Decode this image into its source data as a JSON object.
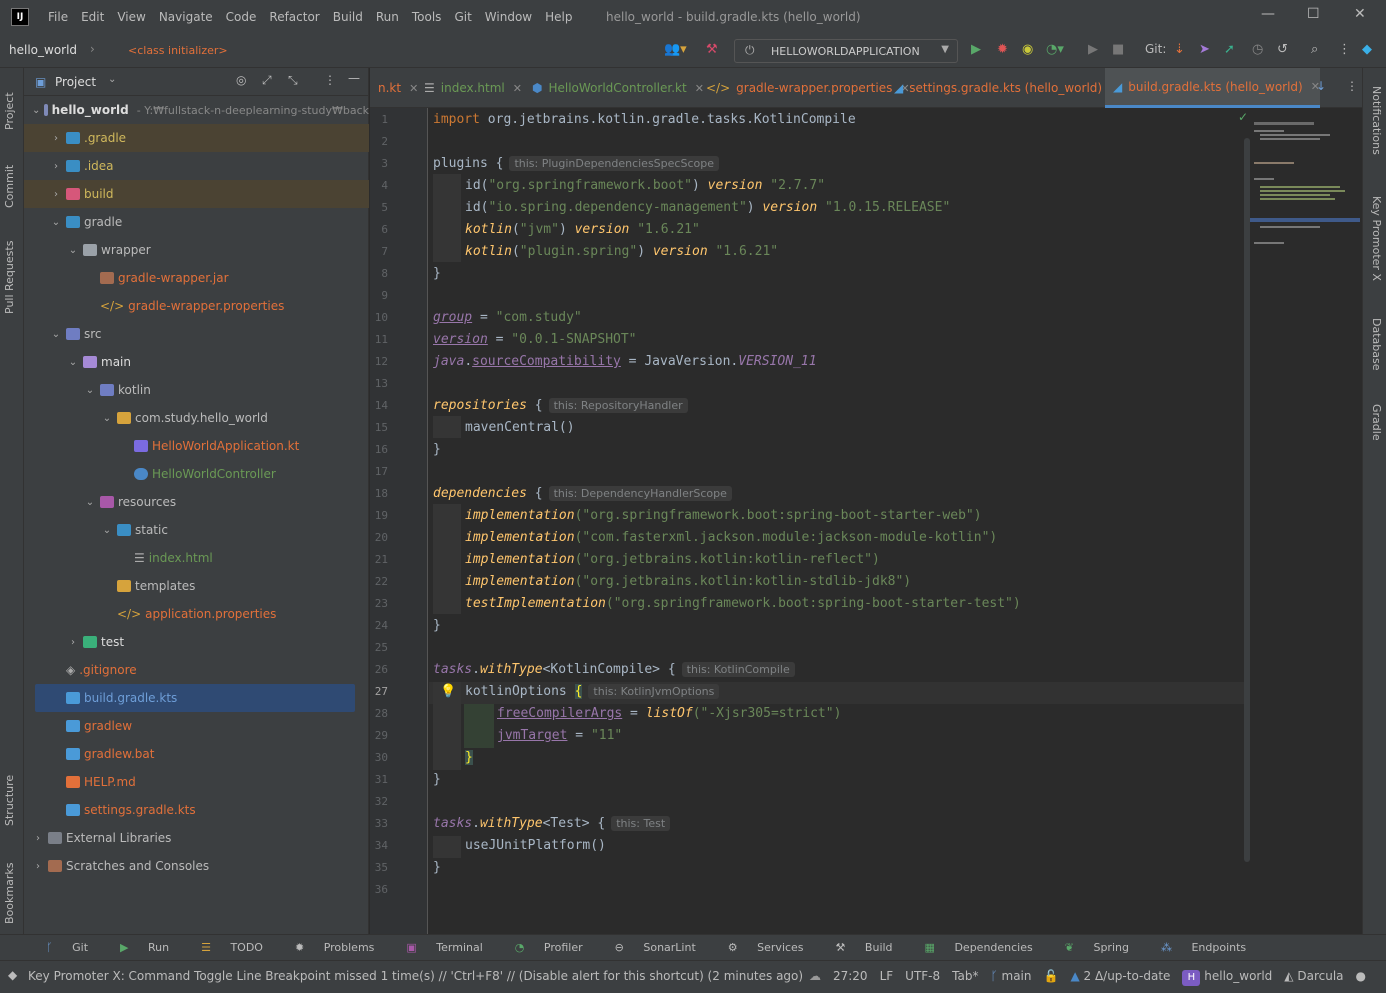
{
  "menubar": {
    "logo": "IJ",
    "items": [
      "File",
      "Edit",
      "View",
      "Navigate",
      "Code",
      "Refactor",
      "Build",
      "Run",
      "Tools",
      "Git",
      "Window",
      "Help"
    ],
    "title": "hello_world - build.gradle.kts (hello_world)",
    "min": "—",
    "max": "☐",
    "close": "✕"
  },
  "navbar": {
    "project": "hello_world",
    "breadcrumb": "<class initializer>",
    "run_config": "HELLOWORLDAPPLICATION",
    "git_label": "Git:"
  },
  "left_strip": [
    "Project",
    "Commit",
    "Pull Requests",
    "Structure",
    "Bookmarks"
  ],
  "right_strip": [
    "Notifications",
    "Key Promoter X",
    "Database",
    "Gradle"
  ],
  "project_panel": {
    "title": "Project",
    "root_name": "hello_world",
    "root_path": "- Y:₩fullstack-n-deeplearning-study₩back",
    "items": [
      {
        "label": ".gradle",
        "color": "#d0b85c"
      },
      {
        "label": ".idea",
        "color": "#d0b85c"
      },
      {
        "label": "build",
        "color": "#d0b85c"
      },
      {
        "label": "gradle",
        "color": "#bbbbbb"
      },
      {
        "label": "wrapper",
        "color": "#bbbbbb"
      },
      {
        "label": "gradle-wrapper.jar",
        "color": "#e2703a"
      },
      {
        "label": "gradle-wrapper.properties",
        "color": "#e2703a"
      },
      {
        "label": "src",
        "color": "#bbbbbb"
      },
      {
        "label": "main",
        "color": "#dddddd"
      },
      {
        "label": "kotlin",
        "color": "#bbbbbb"
      },
      {
        "label": "com.study.hello_world",
        "color": "#bbbbbb"
      },
      {
        "label": "HelloWorldApplication.kt",
        "color": "#e2703a"
      },
      {
        "label": "HelloWorldController",
        "color": "#6a9955"
      },
      {
        "label": "resources",
        "color": "#bbbbbb"
      },
      {
        "label": "static",
        "color": "#bbbbbb"
      },
      {
        "label": "index.html",
        "color": "#6a9955"
      },
      {
        "label": "templates",
        "color": "#bbbbbb"
      },
      {
        "label": "application.properties",
        "color": "#e2703a"
      },
      {
        "label": "test",
        "color": "#dddddd"
      },
      {
        "label": ".gitignore",
        "color": "#e2703a"
      },
      {
        "label": "build.gradle.kts",
        "color": "#6e9ed8"
      },
      {
        "label": "gradlew",
        "color": "#e2703a"
      },
      {
        "label": "gradlew.bat",
        "color": "#e2703a"
      },
      {
        "label": "HELP.md",
        "color": "#e2703a"
      },
      {
        "label": "settings.gradle.kts",
        "color": "#e2703a"
      },
      {
        "label": "External Libraries",
        "color": "#bbbbbb"
      },
      {
        "label": "Scratches and Consoles",
        "color": "#bbbbbb"
      }
    ]
  },
  "tabs": [
    {
      "label": "n.kt",
      "color": "#e2703a"
    },
    {
      "label": "index.html",
      "color": "#6a9955"
    },
    {
      "label": "HelloWorldController.kt",
      "color": "#6a9955"
    },
    {
      "label": "gradle-wrapper.properties",
      "color": "#e2703a"
    },
    {
      "label": "settings.gradle.kts (hello_world)",
      "color": "#e2703a"
    },
    {
      "label": "build.gradle.kts (hello_world)",
      "color": "#e2703a"
    }
  ],
  "code": {
    "line_numbers": [
      "1",
      "2",
      "3",
      "4",
      "5",
      "6",
      "7",
      "8",
      "9",
      "10",
      "11",
      "12",
      "13",
      "14",
      "15",
      "16",
      "17",
      "18",
      "19",
      "20",
      "21",
      "22",
      "23",
      "24",
      "25",
      "26",
      "27",
      "28",
      "29",
      "30",
      "31",
      "32",
      "33",
      "34",
      "35",
      "36"
    ],
    "l1a": "import",
    "l1b": " org.jetbrains.kotlin.gradle.tasks.KotlinCompile",
    "l3": "plugins",
    "l3h": "this: PluginDependenciesSpecScope",
    "l4a": "id(",
    "l4b": "\"org.springframework.boot\"",
    "l4c": ") ",
    "l4d": "version",
    "l4e": " \"2.7.7\"",
    "l5a": "id(",
    "l5b": "\"io.spring.dependency-management\"",
    "l5c": ") ",
    "l5d": "version",
    "l5e": " \"1.0.15.RELEASE\"",
    "l6a": "kotlin",
    "l6b": "(",
    "l6c": "\"jvm\"",
    "l6d": ") ",
    "l6e": "version",
    "l6f": " \"1.6.21\"",
    "l7a": "kotlin",
    "l7b": "(",
    "l7c": "\"plugin.spring\"",
    "l7d": ") ",
    "l7e": "version",
    "l7f": " \"1.6.21\"",
    "l10a": "group",
    "l10b": " = ",
    "l10c": "\"com.study\"",
    "l11a": "version",
    "l11b": " = ",
    "l11c": "\"0.0.1-SNAPSHOT\"",
    "l12a": "java",
    "l12b": ".",
    "l12c": "sourceCompatibility",
    "l12d": " = JavaVersion.",
    "l12e": "VERSION_11",
    "l14": "repositories",
    "l14h": "this: RepositoryHandler",
    "l15": "mavenCentral()",
    "l18": "dependencies",
    "l18h": "this: DependencyHandlerScope",
    "l19a": "implementation",
    "l19b": "(\"org.springframework.boot:spring-boot-starter-web\")",
    "l20a": "implementation",
    "l20b": "(\"com.fasterxml.jackson.module:jackson-module-kotlin\")",
    "l21a": "implementation",
    "l21b": "(\"org.jetbrains.kotlin:kotlin-reflect\")",
    "l22a": "implementation",
    "l22b": "(\"org.jetbrains.kotlin:kotlin-stdlib-jdk8\")",
    "l23a": "testImplementation",
    "l23b": "(\"org.springframework.boot:spring-boot-starter-test\")",
    "l26a": "tasks",
    "l26b": ".",
    "l26c": "withType",
    "l26d": "<KotlinCompile> ",
    "l26h": "this: KotlinCompile",
    "l27": "kotlinOptions ",
    "l27h": "this: KotlinJvmOptions",
    "l28a": "freeCompilerArgs",
    "l28b": " = ",
    "l28c": "listOf",
    "l28d": "(\"-Xjsr305=strict\")",
    "l29a": "jvmTarget",
    "l29b": " = ",
    "l29c": "\"11\"",
    "l33a": "tasks",
    "l33b": ".",
    "l33c": "withType",
    "l33d": "<Test> ",
    "l33h": "this: Test",
    "l34": "useJUnitPlatform()",
    "brace_open": "{",
    "brace_close": "}"
  },
  "bottom_tools": [
    "Git",
    "Run",
    "TODO",
    "Problems",
    "Terminal",
    "Profiler",
    "SonarLint",
    "Services",
    "Build",
    "Dependencies",
    "Spring",
    "Endpoints"
  ],
  "status": {
    "message": "Key Promoter X: Command Toggle Line Breakpoint missed 1 time(s) // 'Ctrl+F8' // (Disable alert for this shortcut) (2 minutes ago)",
    "position": "27:20",
    "line_sep": "LF",
    "encoding": "UTF-8",
    "indent": "Tab*",
    "branch": "main",
    "vcs": "2 Δ/up-to-date",
    "project": "hello_world",
    "theme": "Darcula"
  }
}
